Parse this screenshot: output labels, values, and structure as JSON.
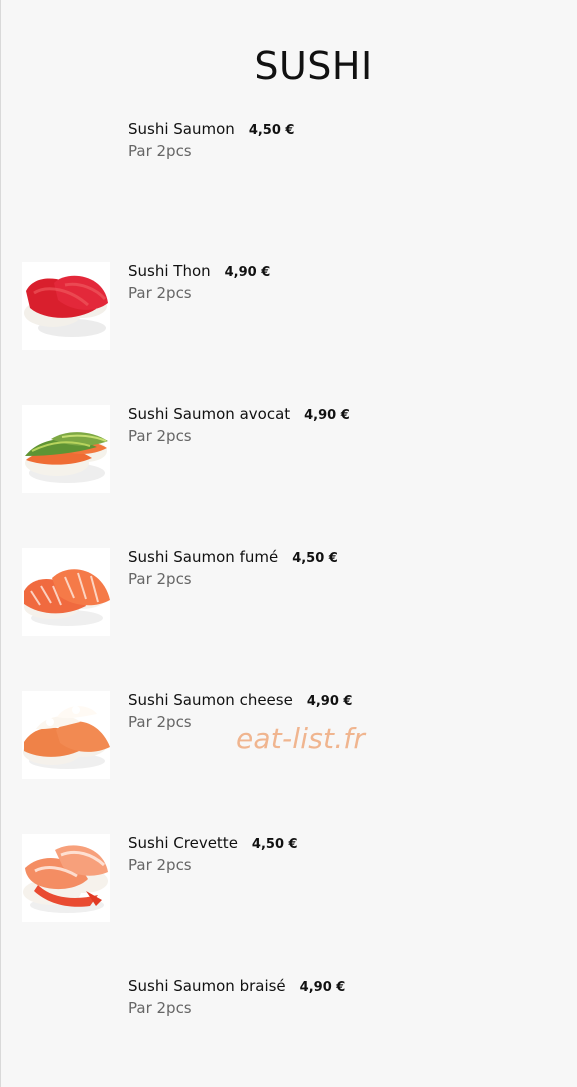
{
  "page": {
    "title": "SUSHI",
    "watermark": "eat-list.fr"
  },
  "items": [
    {
      "name": "Sushi Saumon",
      "price": "4,50 €",
      "portion": "Par 2pcs",
      "image": "none"
    },
    {
      "name": "Sushi Thon",
      "price": "4,90 €",
      "portion": "Par 2pcs",
      "image": "tuna-nigiri"
    },
    {
      "name": "Sushi Saumon avocat",
      "price": "4,90 €",
      "portion": "Par 2pcs",
      "image": "salmon-avocado-nigiri"
    },
    {
      "name": "Sushi Saumon fumé",
      "price": "4,50 €",
      "portion": "Par 2pcs",
      "image": "smoked-salmon-nigiri"
    },
    {
      "name": "Sushi Saumon cheese",
      "price": "4,90 €",
      "portion": "Par 2pcs",
      "image": "salmon-cheese-nigiri"
    },
    {
      "name": "Sushi Crevette",
      "price": "4,50 €",
      "portion": "Par 2pcs",
      "image": "shrimp-nigiri"
    },
    {
      "name": "Sushi Saumon braisé",
      "price": "4,90 €",
      "portion": "Par 2pcs",
      "image": "none"
    }
  ],
  "colors": {
    "background": "#f7f7f7",
    "text": "#111111",
    "muted": "#666666",
    "watermark": "#f0b58f"
  }
}
